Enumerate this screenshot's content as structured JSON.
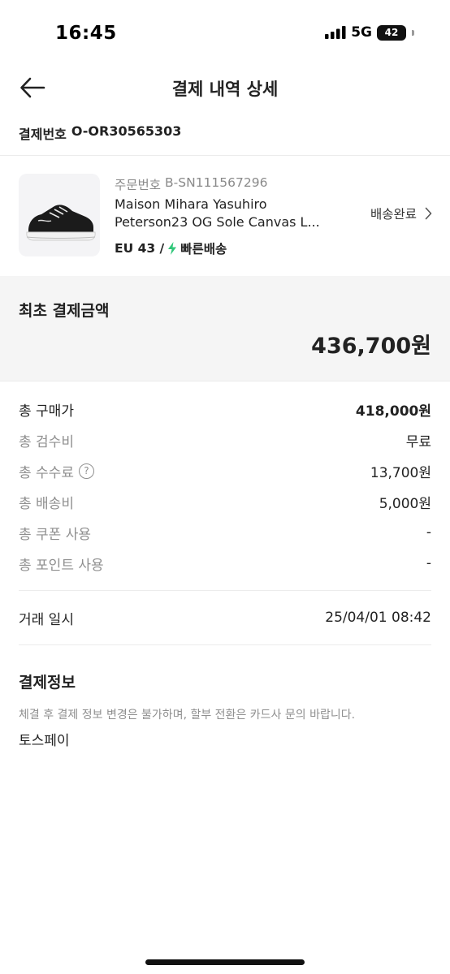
{
  "status_bar": {
    "time": "16:45",
    "network": "5G",
    "battery": "42"
  },
  "header": {
    "title": "결제 내역 상세"
  },
  "payment": {
    "label": "결제번호",
    "number": "O-OR30565303"
  },
  "product": {
    "order_label": "주문번호",
    "order_number": "B-SN111567296",
    "name_line1": "Maison Mihara Yasuhiro",
    "name_line2": "Peterson23 OG Sole Canvas L...",
    "size": "EU 43 /",
    "delivery_type": "빠른배송",
    "status": "배송완료"
  },
  "initial_payment": {
    "label": "최초 결제금액",
    "amount": "436,700원"
  },
  "fees": [
    {
      "label": "총 구매가",
      "value": "418,000원"
    },
    {
      "label": "총 검수비",
      "value": "무료"
    },
    {
      "label": "총 수수료",
      "value": "13,700원"
    },
    {
      "label": "총 배송비",
      "value": "5,000원"
    },
    {
      "label": "총 쿠폰 사용",
      "value": "-"
    },
    {
      "label": "총 포인트 사용",
      "value": "-"
    }
  ],
  "transaction": {
    "label": "거래 일시",
    "value": "25/04/01 08:42"
  },
  "payment_info": {
    "title": "결제정보",
    "notice": "체결 후 결제 정보 변경은 불가하며, 할부 전환은 카드사 문의 바랍니다.",
    "method": "토스페이"
  },
  "icons": {
    "back": "back-arrow-icon",
    "chevron": "chevron-right-icon",
    "help": "question-circle-icon",
    "bolt": "lightning-bolt-icon"
  },
  "colors": {
    "accent_green": "#31c77a",
    "muted_text": "#8f8f8f",
    "panel_bg": "#f5f5f5"
  }
}
